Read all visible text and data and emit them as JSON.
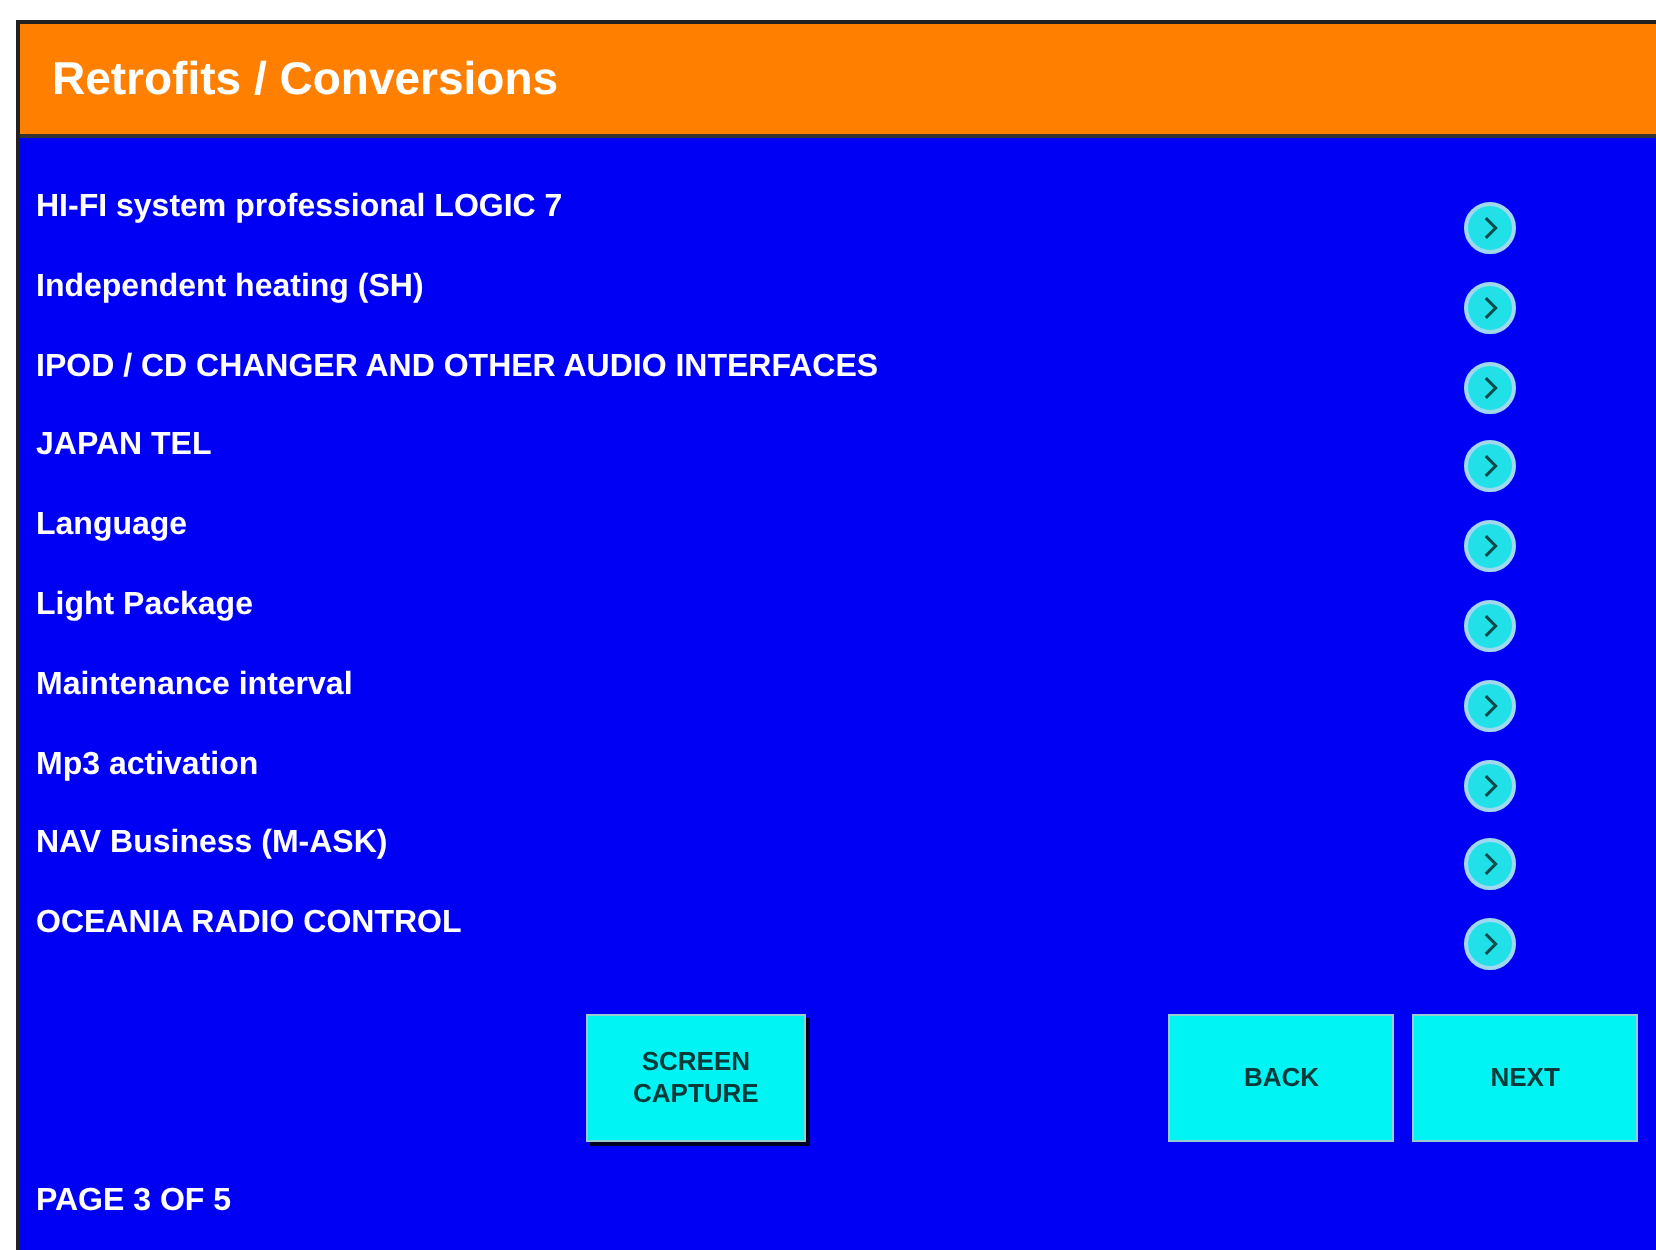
{
  "window": {
    "title": "Retrofits / Conversions"
  },
  "items": [
    {
      "label": "HI-FI system professional LOGIC 7"
    },
    {
      "label": "Independent heating (SH)"
    },
    {
      "label": "IPOD / CD CHANGER AND OTHER AUDIO INTERFACES"
    },
    {
      "label": "JAPAN TEL"
    },
    {
      "label": "Language"
    },
    {
      "label": "Light Package"
    },
    {
      "label": "Maintenance interval"
    },
    {
      "label": "Mp3 activation"
    },
    {
      "label": "NAV Business (M-ASK)"
    },
    {
      "label": "OCEANIA RADIO CONTROL"
    }
  ],
  "buttons": {
    "capture": [
      "SCREEN",
      "CAPTURE"
    ],
    "back": "BACK",
    "next": "NEXT"
  },
  "status": "PAGE 3 OF 5"
}
